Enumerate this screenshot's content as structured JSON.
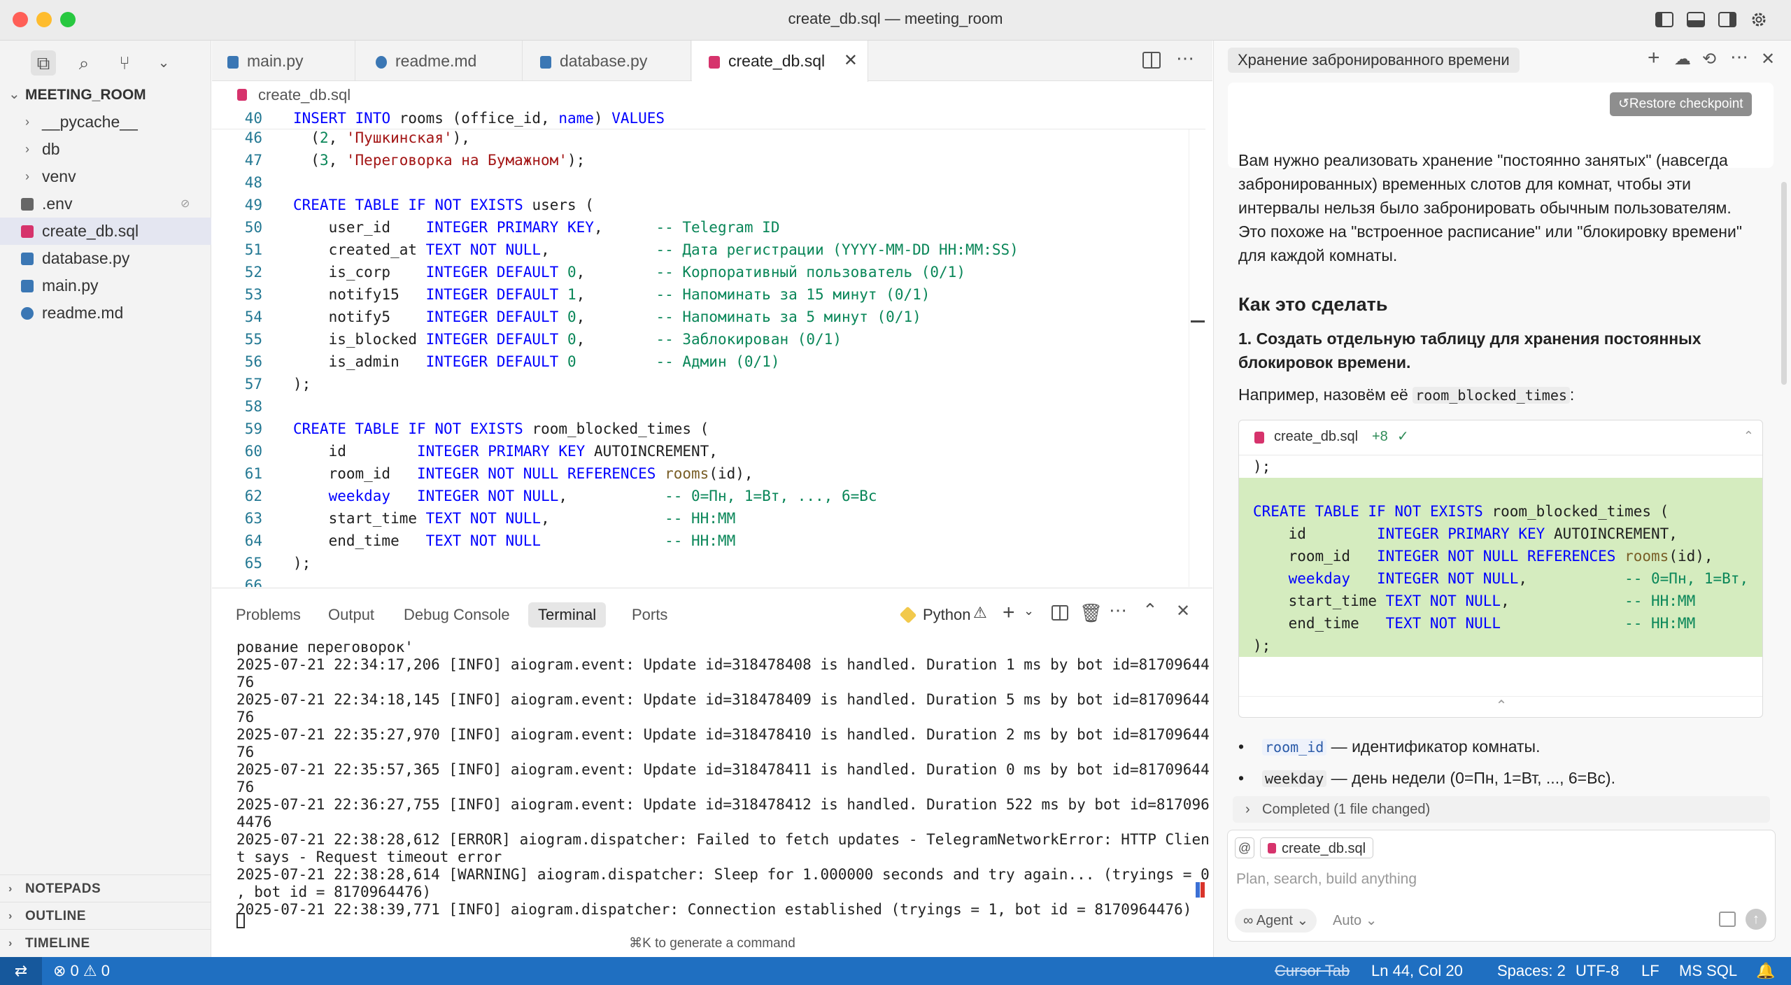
{
  "window": {
    "title": "create_db.sql — meeting_room"
  },
  "colors": {
    "accent": "#1f6fc1",
    "keyword": "#0000ff",
    "comment": "#098658",
    "string": "#a31515",
    "diff_added": "#d5ecbf"
  },
  "sidebar": {
    "project": "MEETING_ROOM",
    "items": [
      {
        "label": "__pycache__",
        "type": "folder"
      },
      {
        "label": "db",
        "type": "folder"
      },
      {
        "label": "venv",
        "type": "folder"
      },
      {
        "label": ".env",
        "type": "settings"
      },
      {
        "label": "create_db.sql",
        "type": "sql"
      },
      {
        "label": "database.py",
        "type": "python"
      },
      {
        "label": "main.py",
        "type": "python"
      },
      {
        "label": "readme.md",
        "type": "info"
      }
    ],
    "sections": [
      "NOTEPADS",
      "OUTLINE",
      "TIMELINE"
    ]
  },
  "editor": {
    "tabs": [
      {
        "label": "main.py"
      },
      {
        "label": "readme.md"
      },
      {
        "label": "database.py"
      },
      {
        "label": "create_db.sql"
      }
    ],
    "breadcrumb": "create_db.sql",
    "lines": [
      {
        "n": "40",
        "t": "INSERT INTO rooms (office_id, name) VALUES"
      },
      {
        "n": "46",
        "t": "  (2, 'Пушкинская'),"
      },
      {
        "n": "47",
        "t": "  (3, 'Переговорка на Бумажном');"
      },
      {
        "n": "48",
        "t": ""
      },
      {
        "n": "49",
        "t": "CREATE TABLE IF NOT EXISTS users ("
      },
      {
        "n": "50",
        "t": "    user_id    INTEGER PRIMARY KEY,      -- Telegram ID"
      },
      {
        "n": "51",
        "t": "    created_at TEXT NOT NULL,            -- Дата регистрации (YYYY-MM-DD HH:MM:SS)"
      },
      {
        "n": "52",
        "t": "    is_corp    INTEGER DEFAULT 0,        -- Корпоративный пользователь (0/1)"
      },
      {
        "n": "53",
        "t": "    notify15   INTEGER DEFAULT 1,        -- Напоминать за 15 минут (0/1)"
      },
      {
        "n": "54",
        "t": "    notify5    INTEGER DEFAULT 0,        -- Напоминать за 5 минут (0/1)"
      },
      {
        "n": "55",
        "t": "    is_blocked INTEGER DEFAULT 0,        -- Заблокирован (0/1)"
      },
      {
        "n": "56",
        "t": "    is_admin   INTEGER DEFAULT 0         -- Админ (0/1)"
      },
      {
        "n": "57",
        "t": ");"
      },
      {
        "n": "58",
        "t": ""
      },
      {
        "n": "59",
        "t": "CREATE TABLE IF NOT EXISTS room_blocked_times ("
      },
      {
        "n": "60",
        "t": "    id        INTEGER PRIMARY KEY AUTOINCREMENT,"
      },
      {
        "n": "61",
        "t": "    room_id   INTEGER NOT NULL REFERENCES rooms(id),"
      },
      {
        "n": "62",
        "t": "    weekday   INTEGER NOT NULL,           -- 0=Пн, 1=Вт, ..., 6=Вс"
      },
      {
        "n": "63",
        "t": "    start_time TEXT NOT NULL,             -- HH:MM"
      },
      {
        "n": "64",
        "t": "    end_time   TEXT NOT NULL              -- HH:MM"
      },
      {
        "n": "65",
        "t": ");"
      },
      {
        "n": "66",
        "t": ""
      }
    ]
  },
  "panel": {
    "tabs": [
      "Problems",
      "Output",
      "Debug Console",
      "Terminal",
      "Ports"
    ],
    "active_tab": "Terminal",
    "shell": "Python",
    "terminal_lines": [
      "рование переговорок'",
      "2025-07-21 22:34:17,206 [INFO] aiogram.event: Update id=318478408 is handled. Duration 1 ms by bot id=81709644",
      "76",
      "2025-07-21 22:34:18,145 [INFO] aiogram.event: Update id=318478409 is handled. Duration 5 ms by bot id=81709644",
      "76",
      "2025-07-21 22:35:27,970 [INFO] aiogram.event: Update id=318478410 is handled. Duration 2 ms by bot id=81709644",
      "76",
      "2025-07-21 22:35:57,365 [INFO] aiogram.event: Update id=318478411 is handled. Duration 0 ms by bot id=81709644",
      "76",
      "2025-07-21 22:36:27,755 [INFO] aiogram.event: Update id=318478412 is handled. Duration 522 ms by bot id=817096",
      "4476",
      "2025-07-21 22:38:28,612 [ERROR] aiogram.dispatcher: Failed to fetch updates - TelegramNetworkError: HTTP Clien",
      "t says - Request timeout error",
      "2025-07-21 22:38:28,614 [WARNING] aiogram.dispatcher: Sleep for 1.000000 seconds and try again... (tryings = 0",
      ", bot id = 8170964476)",
      "2025-07-21 22:38:39,771 [INFO] aiogram.dispatcher: Connection established (tryings = 1, bot id = 8170964476)"
    ],
    "hint": "⌘K to generate a command"
  },
  "chat": {
    "title": "Хранение забронированного времени",
    "restore": "Restore checkpoint",
    "intro": "Вам нужно реализовать хранение \"постоянно занятых\" (навсегда забронированных) временных слотов для комнат, чтобы эти интервалы нельзя было забронировать обычным пользователям. Это похоже на \"встроенное расписание\" или \"блокировку времени\" для каждой комнаты.",
    "heading": "Как это сделать",
    "step1": "1. Создать отдельную таблицу для хранения постоянных блокировок времени.",
    "example_prefix": "Например, назовём её",
    "example_code": "room_blocked_times",
    "example_suffix": ":",
    "diff_file": "create_db.sql",
    "diff_count": "+8",
    "diff_lines": [
      ");",
      "",
      "CREATE TABLE IF NOT EXISTS room_blocked_times (",
      "    id        INTEGER PRIMARY KEY AUTOINCREMENT,",
      "    room_id   INTEGER NOT NULL REFERENCES rooms(id),",
      "    weekday   INTEGER NOT NULL,           -- 0=Пн, 1=Вт,",
      "    start_time TEXT NOT NULL,             -- HH:MM",
      "    end_time   TEXT NOT NULL              -- HH:MM",
      ");"
    ],
    "bullets": [
      {
        "code": "room_id",
        "text": " — идентификатор комнаты."
      },
      {
        "code": "weekday",
        "text": " — день недели (0=Пн, 1=Вт, ..., 6=Вс)."
      }
    ],
    "completed": "Completed (1 file changed)",
    "context_file": "create_db.sql",
    "input_placeholder": "Plan, search, build anything",
    "mode": "Agent",
    "model": "Auto"
  },
  "status": {
    "errors": "0",
    "warnings": "0",
    "cursor_tab": "Cursor Tab",
    "position": "Ln 44, Col 20",
    "spaces": "Spaces: 2",
    "encoding": "UTF-8",
    "eol": "LF",
    "language": "MS SQL"
  }
}
